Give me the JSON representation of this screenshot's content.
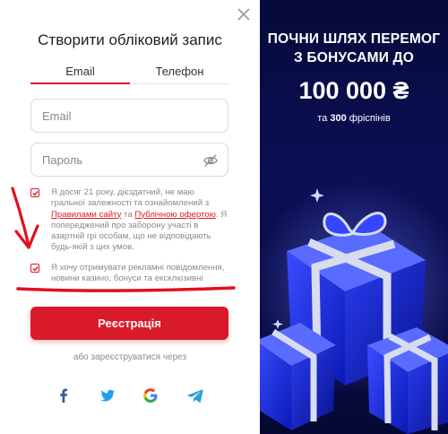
{
  "form": {
    "title": "Створити обліковий запис",
    "tabs": [
      {
        "label": "Email",
        "active": true
      },
      {
        "label": "Телефон",
        "active": false
      }
    ],
    "email": {
      "placeholder": "Email",
      "value": ""
    },
    "password": {
      "placeholder": "Пароль",
      "value": ""
    },
    "consent_1": {
      "checked": true,
      "text_before": "Я досяг 21 року, дієздатний, не маю гральної залежності та ознайомлений з ",
      "link_rules": "Правилами сайту",
      "text_mid": " та ",
      "link_offer": "Публічною офертою",
      "text_after": ". Я попереджений про заборону участі в азартній грі особам, що не відповідають будь-якій з цих умов."
    },
    "consent_2": {
      "checked": true,
      "text": "Я хочу отримувати рекламні повідомлення, новини казино, бонуси та ексклюзивні"
    },
    "register_label": "Реєстрація",
    "or_text": "або зареєструватися через",
    "social": [
      {
        "icon": "facebook-icon",
        "color": "#3b5998"
      },
      {
        "icon": "twitter-icon",
        "color": "#1da1f2"
      },
      {
        "icon": "google-icon",
        "color": "#4285f4"
      },
      {
        "icon": "telegram-icon",
        "color": "#2b9fd9"
      }
    ]
  },
  "promo": {
    "title_line1": "ПОЧНИ ШЛЯХ ПЕРЕМОГ",
    "title_line2": "З БОНУСАМИ ДО",
    "amount": "100 000 ₴",
    "sub_prefix": "та ",
    "sub_bold": "300",
    "sub_suffix": " фріспінів"
  },
  "colors": {
    "accent": "#d91a28",
    "promo_bg": "#0b0f55",
    "annotation": "#e0101e"
  }
}
